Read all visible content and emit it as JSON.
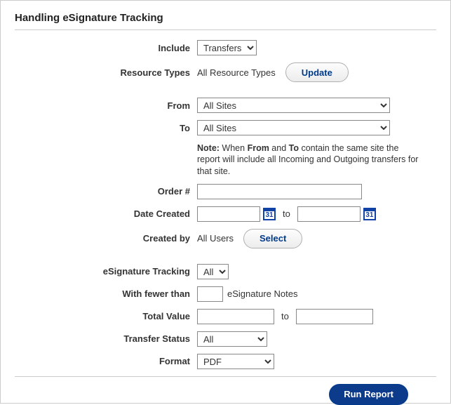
{
  "title": "Handling eSignature Tracking",
  "labels": {
    "include": "Include",
    "resourceTypes": "Resource Types",
    "from": "From",
    "to": "To",
    "order": "Order #",
    "dateCreated": "Date Created",
    "createdBy": "Created by",
    "esigTracking": "eSignature Tracking",
    "withFewer": "With fewer than",
    "totalValue": "Total Value",
    "transferStatus": "Transfer Status",
    "format": "Format"
  },
  "values": {
    "include": "Transfers",
    "resourceTypesText": "All Resource Types",
    "fromSite": "All Sites",
    "toSite": "All Sites",
    "order": "",
    "dateFrom": "",
    "dateTo": "",
    "createdByText": "All Users",
    "esigTracking": "All",
    "fewerThan": "",
    "esigNotesSuffix": "eSignature Notes",
    "valueFrom": "",
    "valueTo": "",
    "transferStatus": "All",
    "format": "PDF"
  },
  "note": {
    "prefix": "Note:",
    "part1": " When ",
    "from": "From",
    "mid": " and ",
    "to": "To",
    "rest": " contain the same site the report will include all Incoming and Outgoing transfers for that site."
  },
  "buttons": {
    "update": "Update",
    "select": "Select",
    "run": "Run Report"
  },
  "misc": {
    "calDay": "31",
    "toWord": "to"
  }
}
